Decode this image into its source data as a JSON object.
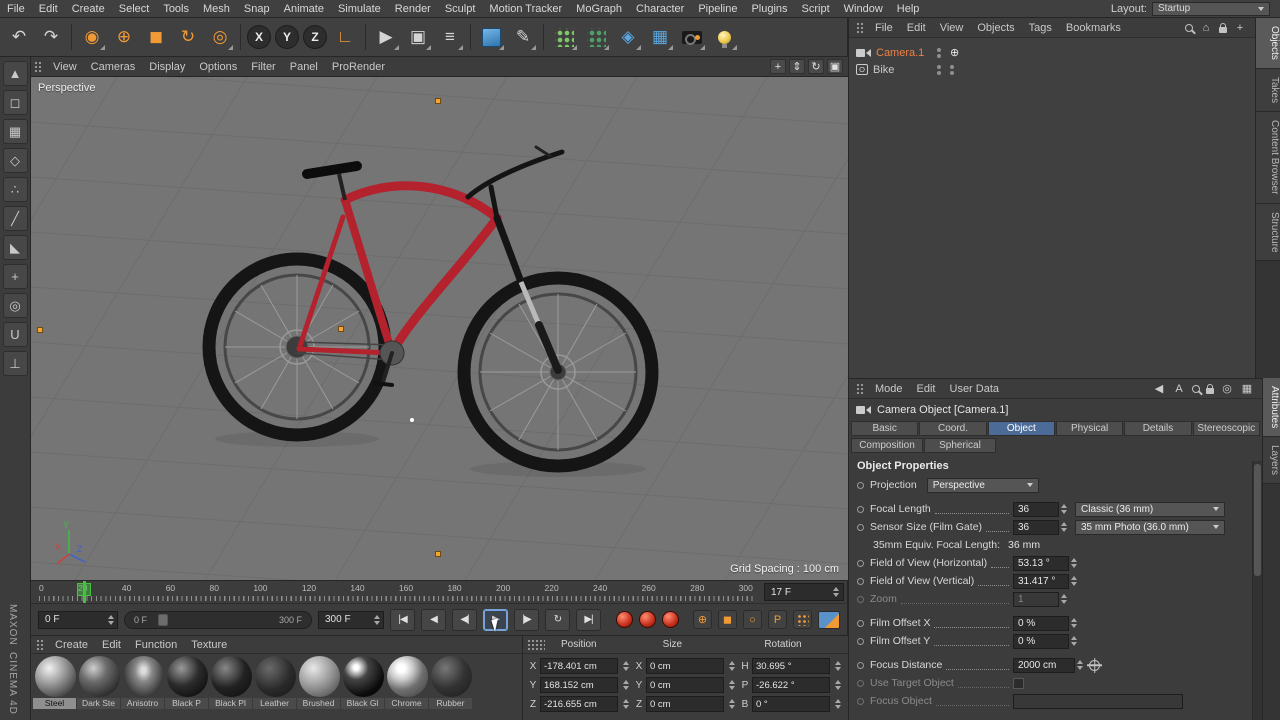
{
  "app": {
    "layout_label": "Layout:",
    "layout_value": "Startup"
  },
  "menubar": {
    "items": [
      "File",
      "Edit",
      "Create",
      "Select",
      "Tools",
      "Mesh",
      "Snap",
      "Animate",
      "Simulate",
      "Render",
      "Sculpt",
      "Motion Tracker",
      "MoGraph",
      "Character",
      "Pipeline",
      "Plugins",
      "Script",
      "Window",
      "Help"
    ]
  },
  "viewport": {
    "menu": [
      "View",
      "Cameras",
      "Display",
      "Options",
      "Filter",
      "Panel",
      "ProRender"
    ],
    "label": "Perspective",
    "grid_spacing": "Grid Spacing : 100 cm",
    "axis": {
      "x": "X",
      "y": "Y",
      "z": "Z"
    }
  },
  "timeline": {
    "ticks": [
      "0",
      "20",
      "40",
      "60",
      "80",
      "100",
      "120",
      "140",
      "160",
      "180",
      "200",
      "220",
      "240",
      "260",
      "280",
      "300"
    ],
    "current_frame": "17 F"
  },
  "transport": {
    "start_field": "0 F",
    "range_start": "0 F",
    "range_end": "300 F",
    "end_field": "300 F"
  },
  "materials": {
    "menu": [
      "Create",
      "Edit",
      "Function",
      "Texture"
    ],
    "items": [
      "Steel",
      "Dark Ste",
      "Anisotro",
      "Black P",
      "Black Pl",
      "Leather",
      "Brushed",
      "Black Gl",
      "Chrome",
      "Rubber"
    ]
  },
  "coordinates": {
    "headers": [
      "Position",
      "Size",
      "Rotation"
    ],
    "labels": {
      "x": "X",
      "y": "Y",
      "z": "Z",
      "h": "H",
      "p": "P",
      "b": "B"
    },
    "position": {
      "x": "-178.401 cm",
      "y": "168.152 cm",
      "z": "-216.655 cm"
    },
    "size": {
      "x": "0 cm",
      "y": "0 cm",
      "z": "0 cm"
    },
    "rotation": {
      "h": "30.695 °",
      "p": "-26.622 °",
      "b": "0 °"
    }
  },
  "object_manager": {
    "menu": [
      "File",
      "Edit",
      "View",
      "Objects",
      "Tags",
      "Bookmarks"
    ],
    "items": [
      {
        "name": "Camera.1"
      },
      {
        "name": "Bike"
      }
    ],
    "side_tabs": [
      "Objects",
      "Takes",
      "Content Browser",
      "Structure"
    ]
  },
  "attributes": {
    "menu": [
      "Mode",
      "Edit",
      "User Data"
    ],
    "title": "Camera Object [Camera.1]",
    "tabs_row1": [
      "Basic",
      "Coord.",
      "Object",
      "Physical",
      "Details",
      "Stereoscopic"
    ],
    "tabs_row2": [
      "Composition",
      "Spherical"
    ],
    "section_title": "Object Properties",
    "fields": {
      "projection": {
        "label": "Projection",
        "value": "Perspective"
      },
      "focal_length": {
        "label": "Focal Length",
        "value": "36",
        "preset": "Classic (36 mm)"
      },
      "sensor_size": {
        "label": "Sensor Size (Film Gate)",
        "value": "36",
        "preset": "35 mm Photo (36.0 mm)"
      },
      "equiv_focal": {
        "label": "35mm Equiv. Focal Length:",
        "value": "36 mm"
      },
      "fov_h": {
        "label": "Field of View (Horizontal)",
        "value": "53.13 °"
      },
      "fov_v": {
        "label": "Field of View (Vertical)",
        "value": "31.417 °"
      },
      "zoom": {
        "label": "Zoom",
        "value": "1"
      },
      "film_offset_x": {
        "label": "Film Offset X",
        "value": "0 %"
      },
      "film_offset_y": {
        "label": "Film Offset Y",
        "value": "0 %"
      },
      "focus_distance": {
        "label": "Focus Distance",
        "value": "2000 cm"
      },
      "use_target": {
        "label": "Use Target Object"
      },
      "focus_object": {
        "label": "Focus Object"
      }
    },
    "side_tabs": [
      "Attributes",
      "Layers"
    ]
  },
  "branding": {
    "top": "MAXON",
    "bottom": "CINEMA 4D"
  },
  "icons": {
    "undo": "↶",
    "redo": "↷",
    "live_selection": "◉",
    "move": "⊕",
    "scale": "◼",
    "rotate": "↻",
    "last_tool": "◎",
    "axis_x": "X",
    "axis_y": "Y",
    "axis_z": "Z",
    "coord_system": "∟",
    "render_view": "▶",
    "render_picture_viewer": "▣",
    "render_settings": "≡",
    "pen": "✎",
    "deformer": "◈",
    "floor": "▦",
    "pan": "+",
    "dolly": "⇕",
    "orbit": "↻",
    "toggle_view": "▣",
    "goto_start": "|◀",
    "prev_key": "◀",
    "prev_frame": "◀|",
    "play": "▶",
    "next_frame": "|▶",
    "loop": "↻",
    "goto_end": "▶|",
    "key_position": "⊕",
    "key_scale": "◼",
    "key_rotation": "○",
    "key_parameter": "P",
    "home": "⌂",
    "add": "+",
    "nav_back": "◀",
    "text_a": "A",
    "target": "◎",
    "menu_grid": "▦",
    "bike_badge": "O",
    "palette": [
      "▲",
      "◻",
      "▦",
      "◇",
      "∴",
      "╱",
      "◣",
      "+",
      "◎",
      "U",
      "⊥"
    ]
  }
}
